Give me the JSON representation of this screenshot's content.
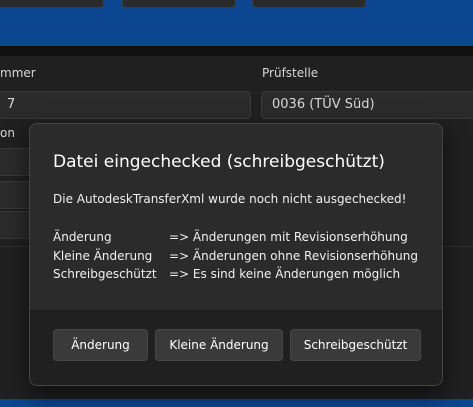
{
  "background": {
    "label_nummer_partial": "mmer",
    "field_nummer_partial": "7",
    "label_pruefstelle": "Prüfstelle",
    "field_pruefstelle_value": "0036 (TÜV Süd)",
    "label_partial_2": "on"
  },
  "dialog": {
    "title": "Datei eingechecked (schreibgeschützt)",
    "message": "Die AutodeskTransferXml wurde noch nicht ausgechecked!",
    "options": [
      {
        "key": "Änderung",
        "desc": "=> Änderungen mit Revisionserhöhung"
      },
      {
        "key": "Kleine Änderung",
        "desc": "=> Änderungen ohne Revisionserhöhung"
      },
      {
        "key": "Schreibgeschützt",
        "desc": "=> Es sind keine Änderungen möglich"
      }
    ],
    "buttons": {
      "aenderung": "Änderung",
      "kleine_aenderung": "Kleine Änderung",
      "schreibgeschuetzt": "Schreibgeschützt"
    }
  },
  "colors": {
    "accent_blue": "#0c4590",
    "dialog_bg": "#2b2b2b",
    "footer_bg": "#202020"
  }
}
